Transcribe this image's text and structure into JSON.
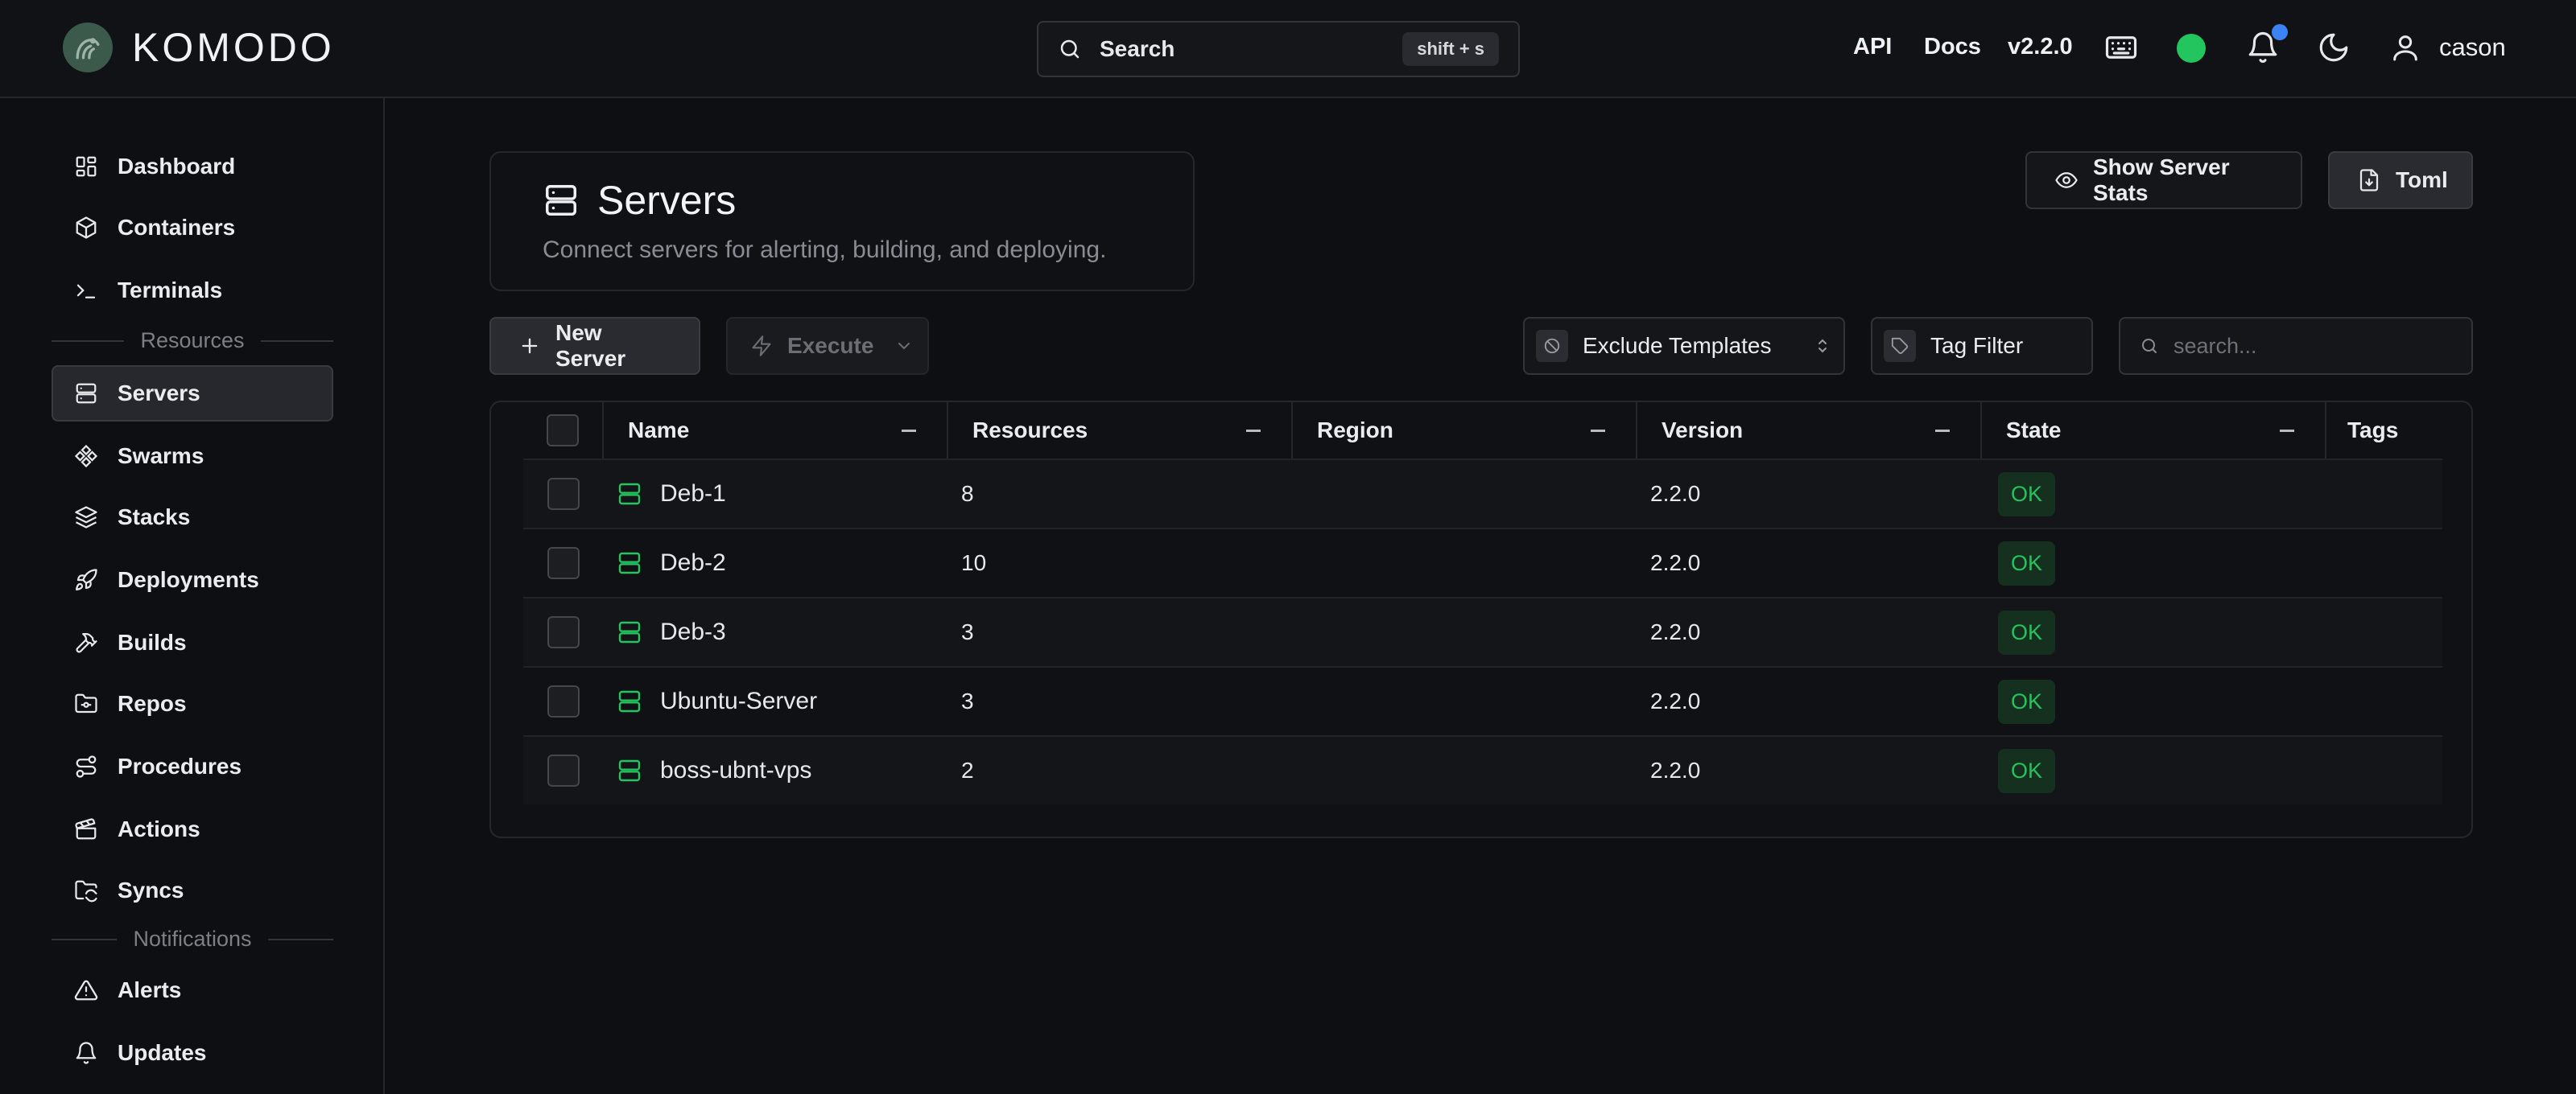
{
  "app": {
    "brand": "KOMODO",
    "accent": "#22c55e"
  },
  "header": {
    "search_label": "Search",
    "search_shortcut": "shift + s",
    "links": {
      "api": "API",
      "docs": "Docs",
      "version": "v2.2.0"
    },
    "user_name": "cason"
  },
  "sidebar": {
    "items": [
      {
        "label": "Dashboard"
      },
      {
        "label": "Containers"
      },
      {
        "label": "Terminals"
      },
      {
        "label": "Servers"
      },
      {
        "label": "Swarms"
      },
      {
        "label": "Stacks"
      },
      {
        "label": "Deployments"
      },
      {
        "label": "Builds"
      },
      {
        "label": "Repos"
      },
      {
        "label": "Procedures"
      },
      {
        "label": "Actions"
      },
      {
        "label": "Syncs"
      },
      {
        "label": "Alerts"
      },
      {
        "label": "Updates"
      }
    ],
    "sections": {
      "resources": "Resources",
      "notifications": "Notifications"
    },
    "active": "Servers"
  },
  "page": {
    "title": "Servers",
    "subtitle": "Connect servers for alerting, building, and deploying."
  },
  "toolbar": {
    "show_stats": "Show Server Stats",
    "toml": "Toml",
    "new_server": "New Server",
    "execute": "Execute",
    "exclude_templates": "Exclude Templates",
    "tag_filter": "Tag Filter",
    "search_placeholder": "search..."
  },
  "table": {
    "columns": [
      "Name",
      "Resources",
      "Region",
      "Version",
      "State",
      "Tags"
    ],
    "rows": [
      {
        "name": "Deb-1",
        "resources": "8",
        "region": "",
        "version": "2.2.0",
        "state": "OK",
        "tags": ""
      },
      {
        "name": "Deb-2",
        "resources": "10",
        "region": "",
        "version": "2.2.0",
        "state": "OK",
        "tags": ""
      },
      {
        "name": "Deb-3",
        "resources": "3",
        "region": "",
        "version": "2.2.0",
        "state": "OK",
        "tags": ""
      },
      {
        "name": "Ubuntu-Server",
        "resources": "3",
        "region": "",
        "version": "2.2.0",
        "state": "OK",
        "tags": ""
      },
      {
        "name": "boss-ubnt-vps",
        "resources": "2",
        "region": "",
        "version": "2.2.0",
        "state": "OK",
        "tags": ""
      }
    ]
  }
}
